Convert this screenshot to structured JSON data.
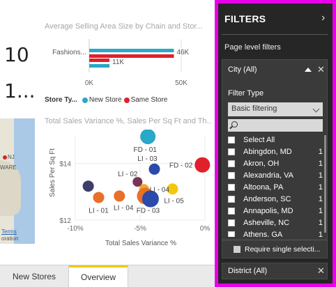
{
  "cards": {
    "card1_value": "10",
    "card2_value": "1..."
  },
  "bar_chart": {
    "title": "Average Selling Area Size by Chain and Stor...",
    "category_label": "Fashions...",
    "legend_title": "Store Ty...",
    "colors": {
      "new_store": "#29a8c9",
      "same_store": "#e0202b"
    },
    "chart_data": {
      "type": "bar",
      "categories": [
        "Fashions..."
      ],
      "series": [
        {
          "name": "New Store",
          "values": [
            46000
          ]
        },
        {
          "name": "Same Store",
          "values": [
            11000
          ]
        }
      ],
      "data_labels": [
        "46K",
        "11K"
      ],
      "xlim": [
        0,
        50000
      ],
      "x_ticks": [
        "0K",
        "50K"
      ]
    }
  },
  "scatter_chart": {
    "title": "Total Sales Variance %, Sales Per Sq Ft and Th...",
    "chart_data": {
      "type": "scatter",
      "xlabel": "Total Sales Variance %",
      "ylabel": "Sales Per Sq Ft",
      "x_ticks": [
        "-10%",
        "-5%",
        "0%"
      ],
      "y_ticks": [
        "$12",
        "$14"
      ],
      "xlim": [
        -10,
        0
      ],
      "ylim": [
        12,
        15
      ],
      "points": [
        {
          "label": "FD - 01",
          "x": -4.4,
          "y": 14.95,
          "size": 11,
          "color": "#29a8c9"
        },
        {
          "label": "FD - 02",
          "x": -0.2,
          "y": 13.95,
          "size": 11,
          "color": "#e0202b"
        },
        {
          "label": "LI - 03",
          "x": -3.9,
          "y": 13.8,
          "size": 8,
          "color": "#2b4aaa"
        },
        {
          "label": "LI - 02",
          "x": -5.2,
          "y": 13.35,
          "size": 7,
          "color": "#7a3355"
        },
        {
          "label": "LI - 04",
          "x": -4.7,
          "y": 13.1,
          "size": 7,
          "color": "#f5a623"
        },
        {
          "label": "LI - 05",
          "x": -2.5,
          "y": 13.1,
          "size": 8,
          "color": "#f2c811"
        },
        {
          "label": "LI - 01",
          "x": -8.2,
          "y": 12.8,
          "size": 8,
          "color": "#e8702a"
        },
        {
          "label": "FD - 03",
          "x": -4.6,
          "y": 12.85,
          "size": 12,
          "color": "#e8702a"
        },
        {
          "label": "",
          "x": -4.2,
          "y": 12.75,
          "size": 12,
          "color": "#2b4aaa"
        },
        {
          "label": "",
          "x": -9.0,
          "y": 13.2,
          "size": 8,
          "color": "#3d3d6b"
        },
        {
          "label": "",
          "x": -6.6,
          "y": 12.85,
          "size": 8,
          "color": "#e8702a"
        }
      ],
      "visible_labels": [
        "FD - 01",
        "FD - 02",
        "LI - 03",
        "LI - 02",
        "LI - 04",
        "LI - 05",
        "LI - 01",
        "FD - 03",
        "LI - 04"
      ]
    }
  },
  "map": {
    "label_nj": "NJ",
    "label_ware": "WARE",
    "terms": "Terms",
    "attribution": "oration"
  },
  "tabs": {
    "new_stores": "New Stores",
    "overview": "Overview"
  },
  "filters": {
    "title": "FILTERS",
    "section": "Page level filters",
    "city_filter": {
      "header": "City (All)",
      "filter_type_label": "Filter Type",
      "filter_type_value": "Basic filtering",
      "select_all": "Select All",
      "items": [
        {
          "name": "Abingdon, MD",
          "count": "1"
        },
        {
          "name": "Akron, OH",
          "count": "1"
        },
        {
          "name": "Alexandria, VA",
          "count": "1"
        },
        {
          "name": "Altoona, PA",
          "count": "1"
        },
        {
          "name": "Anderson, SC",
          "count": "1"
        },
        {
          "name": "Annapolis, MD",
          "count": "1"
        },
        {
          "name": "Asheville, NC",
          "count": "1"
        },
        {
          "name": "Athens, GA",
          "count": "1"
        }
      ],
      "require_single": "Require single selecti..."
    },
    "district_filter": {
      "header": "District (All)"
    }
  },
  "colors": {
    "filters_bg": "#262626",
    "frame": "#e800e8",
    "active_tab": "#f2c811"
  }
}
